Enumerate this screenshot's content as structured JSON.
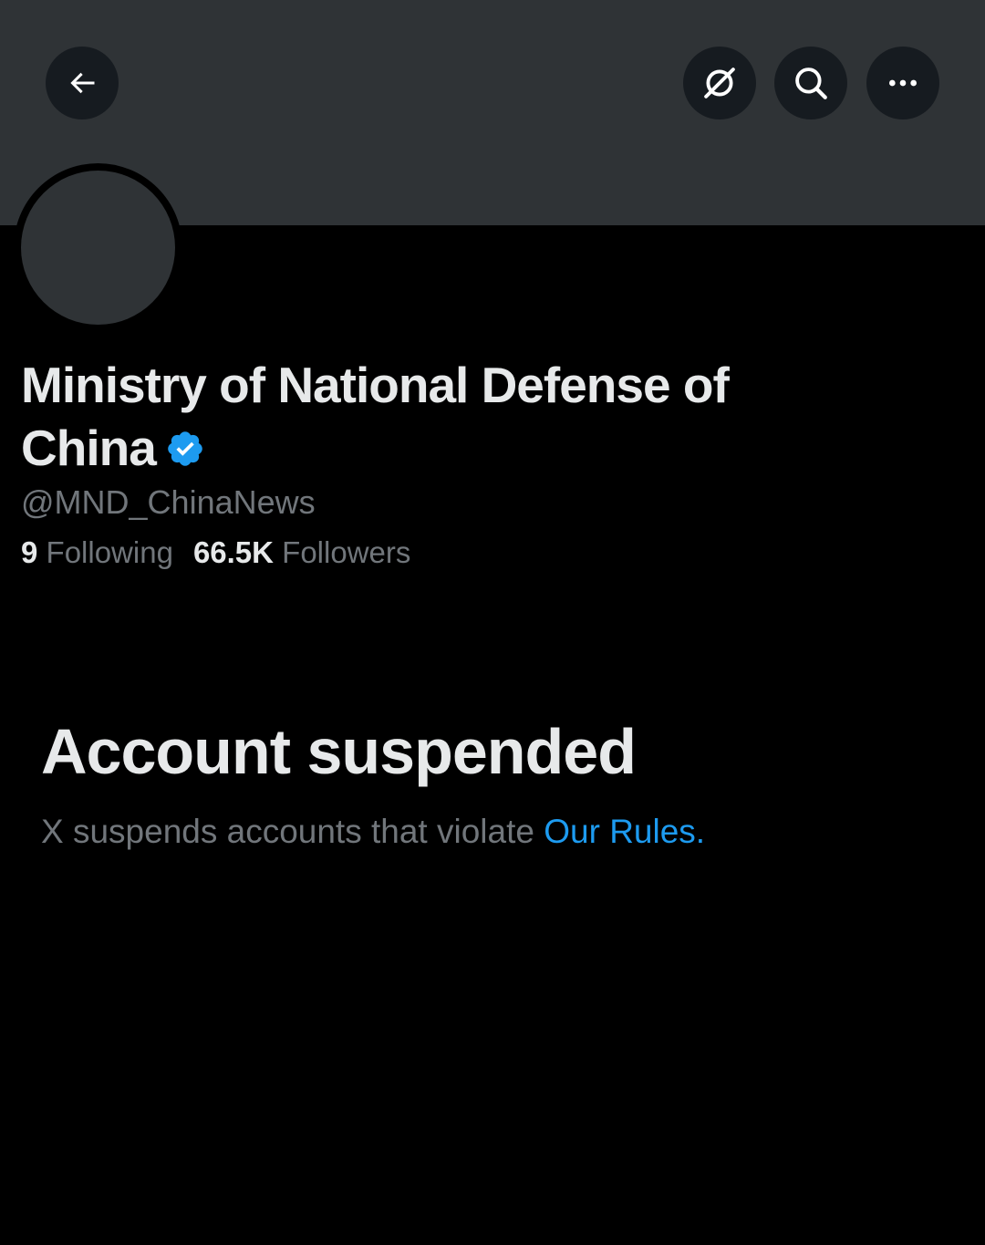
{
  "profile": {
    "display_name": "Ministry of National Defense of China",
    "handle": "@MND_ChinaNews",
    "verified_icon": "verified-badge-icon",
    "following_count": "9",
    "following_label": "Following",
    "followers_count": "66.5K",
    "followers_label": "Followers"
  },
  "suspension": {
    "title": "Account suspended",
    "message": "X suspends accounts that violate ",
    "link_text": "Our Rules",
    "message_end": "."
  },
  "header": {
    "back_icon": "arrow-left-icon",
    "grok_icon": "grok-icon",
    "search_icon": "search-icon",
    "more_icon": "more-horizontal-icon"
  },
  "colors": {
    "background": "#000000",
    "banner": "#2f3336",
    "primary_text": "#e7e9ea",
    "secondary_text": "#71767b",
    "link": "#1d9bf0",
    "verified": "#1d9bf0"
  }
}
